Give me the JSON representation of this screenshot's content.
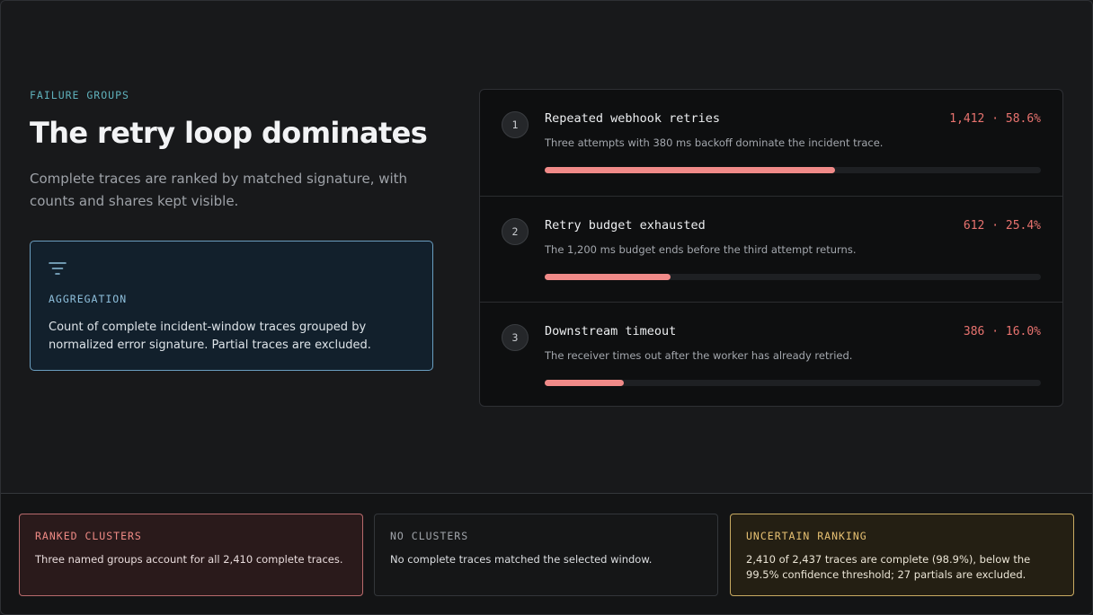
{
  "header": {
    "eyebrow": "FAILURE GROUPS",
    "title": "The retry loop dominates",
    "subtitle": "Complete traces are ranked by matched signature, with counts and shares kept visible."
  },
  "aggregation": {
    "icon": "filter-icon",
    "label": "AGGREGATION",
    "text": "Count of complete incident-window traces grouped by normalized error signature. Partial traces are excluded.",
    "accent": "#8ebfdc"
  },
  "clusters": [
    {
      "rank": "1",
      "title": "Repeated webhook retries",
      "stat": "1,412 · 58.6%",
      "description": "Three attempts with 380 ms backoff dominate the incident trace.",
      "share": 0.586
    },
    {
      "rank": "2",
      "title": "Retry budget exhausted",
      "stat": "612 · 25.4%",
      "description": "The 1,200 ms budget ends before the third attempt returns.",
      "share": 0.254
    },
    {
      "rank": "3",
      "title": "Downstream timeout",
      "stat": "386 · 16.0%",
      "description": "The receiver times out after the worker has already retried.",
      "share": 0.16
    }
  ],
  "states": {
    "ranked": {
      "label": "RANKED CLUSTERS",
      "text": "Three named groups account for all 2,410 complete traces.",
      "color": "#ef8a85"
    },
    "none": {
      "label": "NO CLUSTERS",
      "text": "No complete traces matched the selected window.",
      "color": "#a0a4aa"
    },
    "uncertain": {
      "label": "UNCERTAIN RANKING",
      "text": "2,410 of 2,437 traces are complete (98.9%), below the 99.5% confidence threshold; 27 partials are excluded.",
      "color": "#e6c072"
    }
  },
  "colors": {
    "bar_fill": "#f08a88",
    "stat": "#e9736f",
    "eyebrow": "#5fb1bb"
  }
}
